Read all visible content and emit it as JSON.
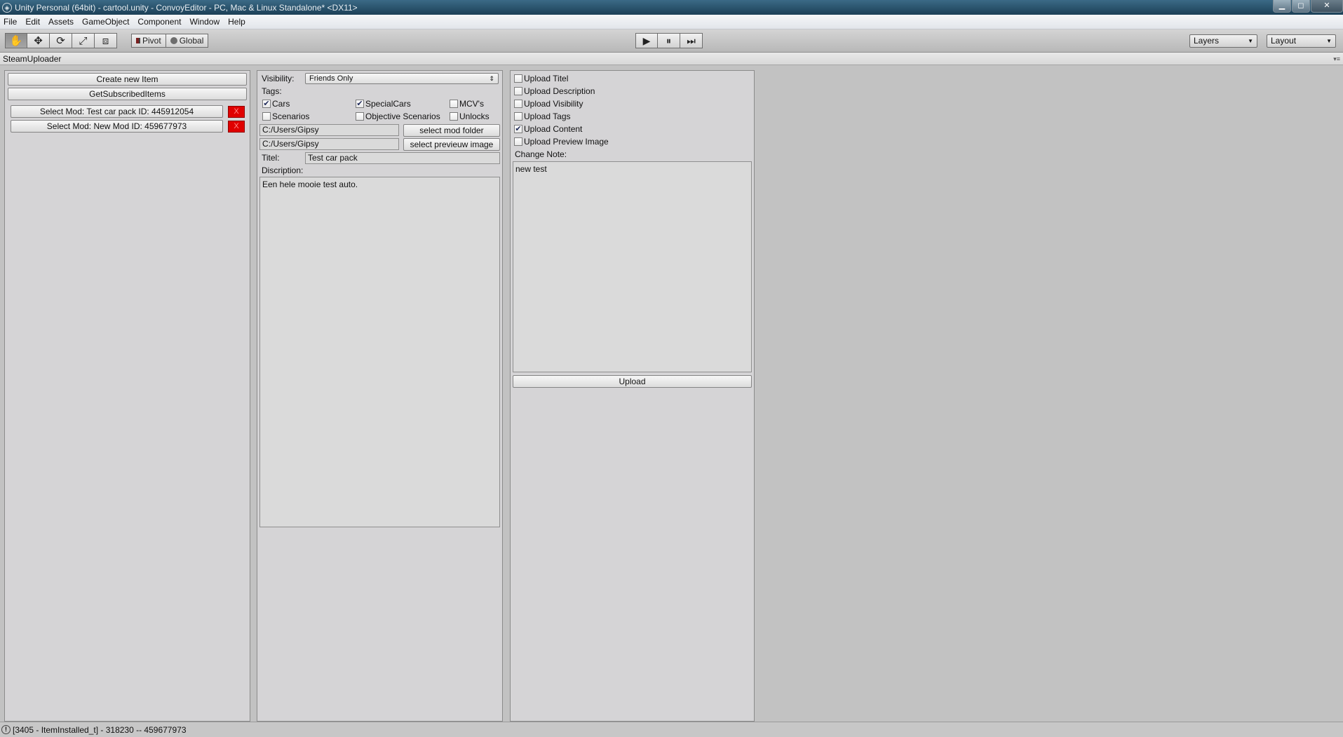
{
  "window": {
    "title": "Unity Personal (64bit) - cartool.unity - ConvoyEditor - PC, Mac & Linux Standalone* <DX11>",
    "controls": {
      "minimize": "▁",
      "maximize": "◻",
      "close": "✕"
    }
  },
  "menu": {
    "items": [
      "File",
      "Edit",
      "Assets",
      "GameObject",
      "Component",
      "Window",
      "Help"
    ]
  },
  "toolbar": {
    "tools": [
      "hand-icon",
      "move-icon",
      "rotate-icon",
      "scale-icon",
      "rect-icon"
    ],
    "tool_glyphs": [
      "✋",
      "✥",
      "⟳",
      "⤢",
      "⧈"
    ],
    "pivot_label": "Pivot",
    "global_label": "Global",
    "play_glyph": "▶",
    "pause_glyph": "⏸",
    "step_glyph": "⏭",
    "layers_label": "Layers",
    "layout_label": "Layout"
  },
  "tab": {
    "title": "SteamUploader"
  },
  "left_panel": {
    "create_label": "Create new Item",
    "subscribed_label": "GetSubscribedItems",
    "mods": [
      {
        "label": "Select Mod: Test car pack ID: 445912054",
        "delete": "X"
      },
      {
        "label": "Select Mod: New Mod ID: 459677973",
        "delete": "X"
      }
    ]
  },
  "middle_panel": {
    "visibility_label": "Visibility:",
    "visibility_value": "Friends Only",
    "tags_label": "Tags:",
    "tags": [
      {
        "label": "Cars",
        "checked": true
      },
      {
        "label": "SpecialCars",
        "checked": true
      },
      {
        "label": "MCV's",
        "checked": false
      },
      {
        "label": "Scenarios",
        "checked": false
      },
      {
        "label": "Objective Scenarios",
        "checked": false
      },
      {
        "label": "Unlocks",
        "checked": false
      }
    ],
    "folder_path": "C:/Users/Gipsy",
    "select_folder_label": "select mod folder",
    "image_path": "C:/Users/Gipsy",
    "select_image_label": "select previeuw image",
    "title_label": "Titel:",
    "title_value": "Test car pack",
    "description_label": "Discription:",
    "description_value": "Een hele mooie test auto."
  },
  "right_panel": {
    "options": [
      {
        "label": "Upload Titel",
        "checked": false
      },
      {
        "label": "Upload Description",
        "checked": false
      },
      {
        "label": "Upload Visibility",
        "checked": false
      },
      {
        "label": "Upload Tags",
        "checked": false
      },
      {
        "label": "Upload Content",
        "checked": true
      },
      {
        "label": "Upload Preview Image",
        "checked": false
      }
    ],
    "change_note_label": "Change Note:",
    "change_note_value": "new test",
    "upload_label": "Upload"
  },
  "status": {
    "text": "[3405 - ItemInstalled_t] - 318230 -- 459677973",
    "icon": "!"
  }
}
